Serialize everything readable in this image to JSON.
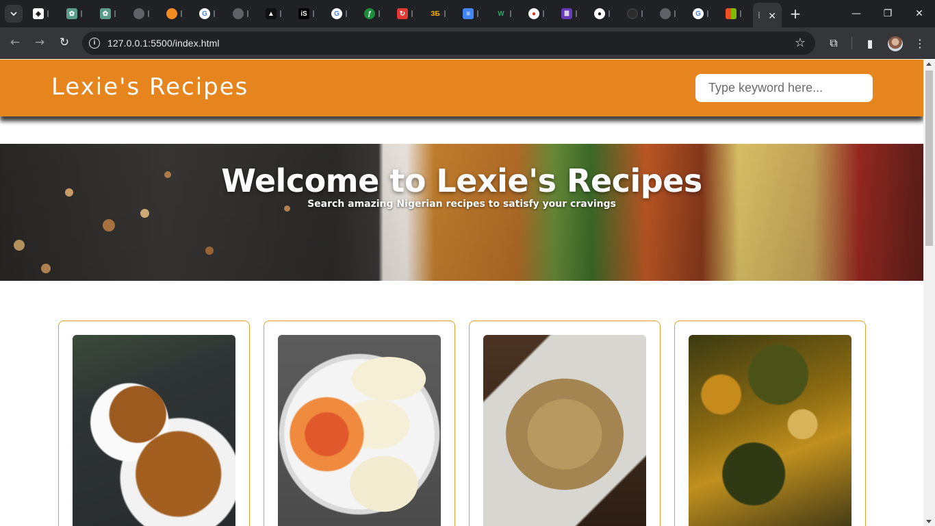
{
  "browser": {
    "url_host": "127.0.0.1",
    "url_path": ":5500/index.html",
    "active_tab_close": "✕",
    "new_tab": "+",
    "window": {
      "minimize": "—",
      "restore": "❐",
      "close": "✕"
    }
  },
  "header": {
    "logo": "Lexie's Recipes",
    "search_placeholder": "Type keyword here..."
  },
  "hero": {
    "title": "Welcome to Lexie's Recipes",
    "subtitle": "Search amazing Nigerian recipes to satisfy your cravings"
  },
  "colors": {
    "brand_orange": "#e6841e",
    "card_border": "#e6a02a"
  },
  "cards": [
    {
      "image": "beans-porridge-photo"
    },
    {
      "image": "yam-and-egg-photo"
    },
    {
      "image": "fried-rice-photo"
    },
    {
      "image": "vegetable-soup-photo"
    }
  ]
}
